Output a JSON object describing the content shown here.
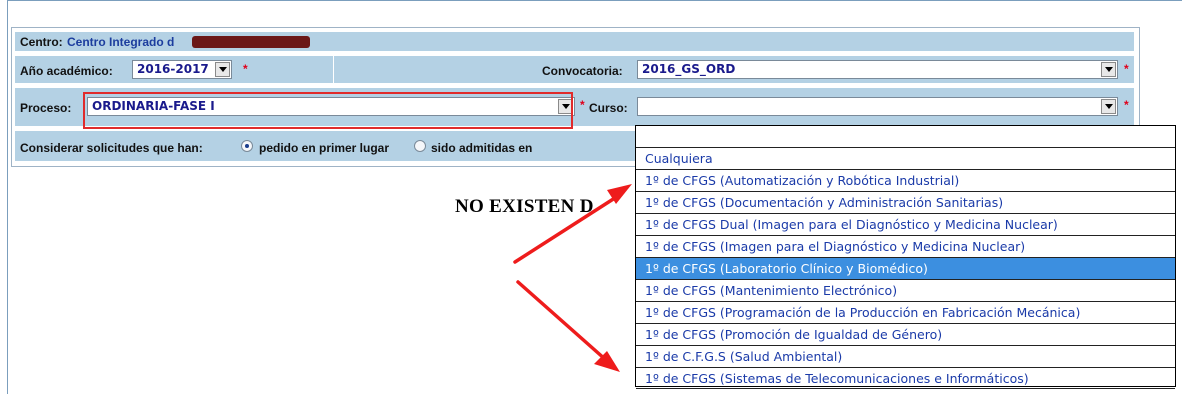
{
  "header": {
    "centro_label": "Centro:",
    "centro_value": "Centro Integrado d"
  },
  "row_academico": {
    "anio_label": "Año académico:",
    "anio_value": "2016-2017",
    "convocatoria_label": "Convocatoria:",
    "convocatoria_value": "2016_GS_ORD",
    "required_mark": "*"
  },
  "row_proceso": {
    "proceso_label": "Proceso:",
    "proceso_value": "ORDINARIA-FASE I",
    "curso_label": "Curso:",
    "curso_value": "",
    "required_mark": "*"
  },
  "row_considerar": {
    "label": "Considerar solicitudes que han:",
    "option_1": "pedido en primer lugar",
    "option_2": "sido admitidas en",
    "selected": "pedido en primer lugar"
  },
  "message": {
    "no_data": "NO EXISTEN D"
  },
  "curso_dropdown": {
    "selected_index": 6,
    "options": [
      "",
      "Cualquiera",
      "1º de CFGS (Automatización y Robótica Industrial)",
      "1º de CFGS (Documentación y Administración Sanitarias)",
      "1º de CFGS Dual (Imagen para el Diagnóstico y Medicina Nuclear)",
      "1º de CFGS (Imagen para el Diagnóstico y Medicina Nuclear)",
      "1º de CFGS (Laboratorio Clínico y Biomédico)",
      "1º de CFGS (Mantenimiento Electrónico)",
      "1º de CFGS (Programación de la Producción en Fabricación Mecánica)",
      "1º de CFGS (Promoción de Igualdad de Género)",
      "1º de C.F.G.S (Salud Ambiental)",
      "1º de CFGS (Sistemas de Telecomunicaciones e Informáticos)"
    ]
  },
  "colors": {
    "bar_background": "#b4d1e4",
    "highlight_border": "#e02b2b",
    "selected_option": "#3c8fe0",
    "link_blue": "#1c3d9e",
    "required": "#e0001b"
  },
  "annotations": {
    "arrow_color": "#ee1c1c",
    "redaction_color": "#6b1818"
  }
}
